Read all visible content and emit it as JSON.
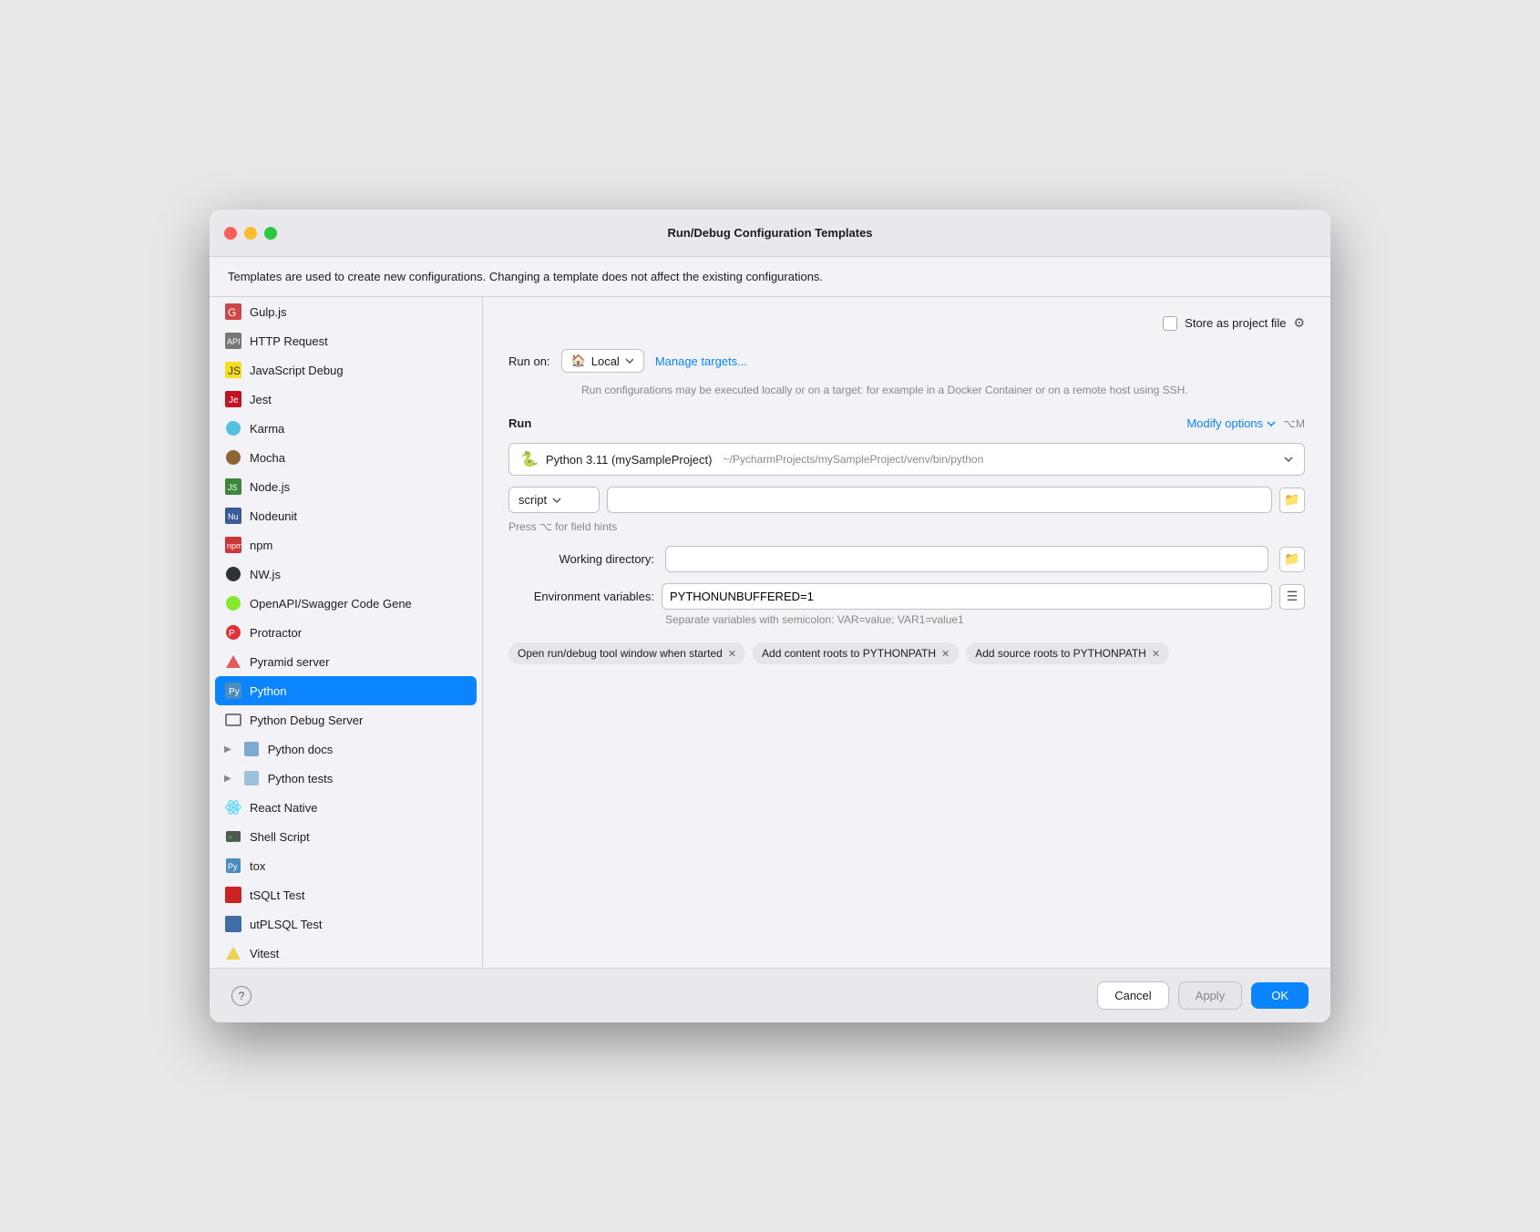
{
  "window": {
    "title": "Run/Debug Configuration Templates"
  },
  "info_bar": {
    "text": "Templates are used to create new configurations. Changing a template does not affect the existing configurations."
  },
  "sidebar": {
    "items": [
      {
        "id": "gulp",
        "label": "Gulp.js",
        "icon": "🟥",
        "selected": false,
        "expandable": false
      },
      {
        "id": "http-request",
        "label": "HTTP Request",
        "icon": "📋",
        "selected": false,
        "expandable": false
      },
      {
        "id": "javascript-debug",
        "label": "JavaScript Debug",
        "icon": "🟨",
        "selected": false,
        "expandable": false
      },
      {
        "id": "jest",
        "label": "Jest",
        "icon": "🧪",
        "selected": false,
        "expandable": false
      },
      {
        "id": "karma",
        "label": "Karma",
        "icon": "🦅",
        "selected": false,
        "expandable": false
      },
      {
        "id": "mocha",
        "label": "Mocha",
        "icon": "🟤",
        "selected": false,
        "expandable": false
      },
      {
        "id": "nodejs",
        "label": "Node.js",
        "icon": "🟩",
        "selected": false,
        "expandable": false
      },
      {
        "id": "nodeunit",
        "label": "Nodeunit",
        "icon": "🔷",
        "selected": false,
        "expandable": false
      },
      {
        "id": "npm",
        "label": "npm",
        "icon": "🟥",
        "selected": false,
        "expandable": false
      },
      {
        "id": "nwjs",
        "label": "NW.js",
        "icon": "⚫",
        "selected": false,
        "expandable": false
      },
      {
        "id": "openapi",
        "label": "OpenAPI/Swagger Code Gene",
        "icon": "🟢",
        "selected": false,
        "expandable": false
      },
      {
        "id": "protractor",
        "label": "Protractor",
        "icon": "🔴",
        "selected": false,
        "expandable": false
      },
      {
        "id": "pyramid",
        "label": "Pyramid server",
        "icon": "🔺",
        "selected": false,
        "expandable": false
      },
      {
        "id": "python",
        "label": "Python",
        "icon": "🐍",
        "selected": true,
        "expandable": false
      },
      {
        "id": "python-debug-server",
        "label": "Python Debug Server",
        "icon": "🖥",
        "selected": false,
        "expandable": false
      },
      {
        "id": "python-docs",
        "label": "Python docs",
        "icon": "📝",
        "selected": false,
        "expandable": true
      },
      {
        "id": "python-tests",
        "label": "Python tests",
        "icon": "🧪",
        "selected": false,
        "expandable": true
      },
      {
        "id": "react-native",
        "label": "React Native",
        "icon": "⚛️",
        "selected": false,
        "expandable": false
      },
      {
        "id": "shell-script",
        "label": "Shell Script",
        "icon": "💻",
        "selected": false,
        "expandable": false
      },
      {
        "id": "tox",
        "label": "tox",
        "icon": "🐍",
        "selected": false,
        "expandable": false
      },
      {
        "id": "tsqlt",
        "label": "tSQLt Test",
        "icon": "🟥",
        "selected": false,
        "expandable": false
      },
      {
        "id": "utplsql",
        "label": "utPLSQL Test",
        "icon": "🔵",
        "selected": false,
        "expandable": false
      },
      {
        "id": "vitest",
        "label": "Vitest",
        "icon": "🟨",
        "selected": false,
        "expandable": false
      }
    ]
  },
  "right_panel": {
    "store_as_project_file": {
      "label": "Store as project file",
      "checked": false
    },
    "run_on": {
      "label": "Run on:",
      "value": "Local",
      "manage_targets_link": "Manage targets..."
    },
    "run_on_description": "Run configurations may be executed locally or on a target: for\nexample in a Docker Container or on a remote host using SSH.",
    "run_section": {
      "title": "Run",
      "modify_options": {
        "label": "Modify options",
        "shortcut": "⌥M"
      }
    },
    "interpreter": {
      "label": "Python 3.11 (mySampleProject)",
      "path": "~/PycharmProjects/mySampleProject/venv/bin/python"
    },
    "script": {
      "type": "script",
      "placeholder": ""
    },
    "field_hints": "Press ⌥ for field hints",
    "working_directory": {
      "label": "Working directory:",
      "value": ""
    },
    "environment_variables": {
      "label": "Environment variables:",
      "value": "PYTHONUNBUFFERED=1",
      "hint": "Separate variables with semicolon: VAR=value; VAR1=value1"
    },
    "tags": [
      {
        "id": "open-run-debug",
        "label": "Open run/debug tool window when started",
        "closable": true
      },
      {
        "id": "add-content-roots",
        "label": "Add content roots to PYTHONPATH",
        "closable": true
      },
      {
        "id": "add-source-roots",
        "label": "Add source roots to PYTHONPATH",
        "closable": true
      }
    ]
  },
  "bottom_bar": {
    "help_label": "?",
    "cancel_label": "Cancel",
    "apply_label": "Apply",
    "ok_label": "OK"
  }
}
